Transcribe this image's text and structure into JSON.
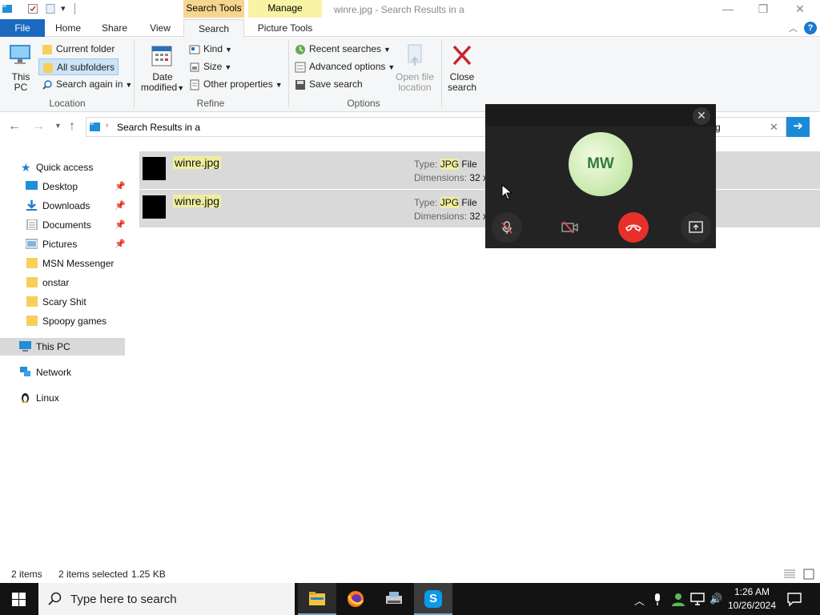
{
  "window": {
    "title": "winre.jpg - Search Results in a",
    "context_tabs": {
      "search_tools": "Search Tools",
      "manage": "Manage"
    },
    "colors": {
      "search_tools_bg": "#f6d58e",
      "manage_bg": "#f8f3a5",
      "file_tab_bg": "#1b6ac0"
    }
  },
  "tabs": {
    "file": "File",
    "home": "Home",
    "share": "Share",
    "view": "View",
    "search": "Search",
    "picture_tools": "Picture Tools"
  },
  "ribbon": {
    "location": {
      "this_pc_line1": "This",
      "this_pc_line2": "PC",
      "current_folder": "Current folder",
      "all_subfolders": "All subfolders",
      "search_again_in": "Search again in",
      "label": "Location"
    },
    "refine": {
      "date_line1": "Date",
      "date_line2": "modified",
      "kind": "Kind",
      "size": "Size",
      "other_properties": "Other properties",
      "label": "Refine"
    },
    "options": {
      "recent_searches": "Recent searches",
      "advanced_options": "Advanced options",
      "save_search": "Save search",
      "open_file_line1": "Open file",
      "open_file_line2": "location",
      "label": "Options"
    },
    "close": {
      "line1": "Close",
      "line2": "search"
    }
  },
  "address": {
    "path": "Search Results in a",
    "search_value": "g"
  },
  "nav": {
    "quick_access": "Quick access",
    "items": [
      "Desktop",
      "Downloads",
      "Documents",
      "Pictures",
      "MSN Messenger",
      "onstar",
      "Scary Shit",
      "Spoopy games"
    ],
    "this_pc": "This PC",
    "network": "Network",
    "linux": "Linux"
  },
  "results": [
    {
      "name": "winre.jpg",
      "type_label": "Type:",
      "type_hl": "JPG",
      "type_rest": "File",
      "dim_label": "Dimensions:",
      "dim_value": "32 x"
    },
    {
      "name": "winre.jpg",
      "type_label": "Type:",
      "type_hl": "JPG",
      "type_rest": "File",
      "dim_label": "Dimensions:",
      "dim_value": "32 x"
    }
  ],
  "call": {
    "initials": "MW",
    "colors": {
      "hangup": "#e8302a",
      "avatar_text": "#2f7d3a"
    }
  },
  "status": {
    "items": "2 items",
    "selected": "2 items selected",
    "size": "1.25 KB"
  },
  "taskbar": {
    "search_placeholder": "Type here to search",
    "time": "1:26 AM",
    "date": "10/26/2024"
  }
}
